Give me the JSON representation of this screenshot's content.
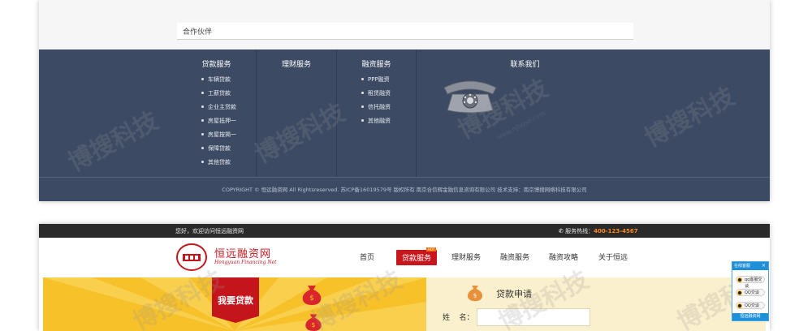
{
  "partners": {
    "title": "合作伙伴"
  },
  "footer": {
    "columns": [
      {
        "title": "贷款服务",
        "items": [
          "车辆贷款",
          "工薪贷款",
          "企业主贷款",
          "房屋抵押一",
          "房屋按揭一",
          "保障贷款",
          "其他贷款"
        ]
      },
      {
        "title": "理财服务",
        "items": []
      },
      {
        "title": "融资服务",
        "items": [
          "PPP融资",
          "租赁融资",
          "信托融资",
          "其他融资"
        ]
      },
      {
        "title": "联系我们",
        "items": []
      }
    ],
    "copyright": "COPYRIGHT © 恒远融资网 All Rightsreserved. 苏ICP备16019579号  版权所有 南京合信辉金融信息咨询有限公司  技术支持：南京博搜网络科技有限公司"
  },
  "site": {
    "welcome": "您好，欢迎访问恒远融资网",
    "hotline_label": "服务热线：",
    "hotline_number": "400-123-4567",
    "logo_cn": "恒远融资网",
    "logo_en": "Hengyuan Financing Net",
    "nav": [
      "首页",
      "贷款服务",
      "理财服务",
      "融资服务",
      "融资攻略",
      "关于恒远"
    ],
    "nav_active_index": 1,
    "nav_hot_badge": "HOT",
    "banner_ribbon": "我要贷款",
    "form_title": "贷款申请",
    "name_label": "姓    名："
  },
  "chat": {
    "header": "在线客服",
    "items": [
      "qq客服交谈",
      "QQ交谈",
      "QQ交谈"
    ],
    "footer": "恒远融资网"
  },
  "watermark": {
    "text": "博搜科技",
    "url": "www.njboso.com"
  },
  "colors": {
    "footer_bg": "#3c4a63",
    "brand_red": "#c4171d",
    "banner_yellow": "#f7c12a",
    "hotline_orange": "#ff8a1e"
  }
}
